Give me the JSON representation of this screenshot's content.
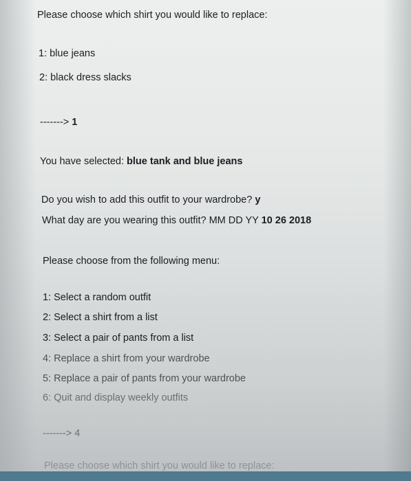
{
  "console": {
    "header_prompt": "Please choose which shirt you would like to replace:",
    "pants_options": [
      "1: blue jeans",
      "2: black dress slacks"
    ],
    "first_input": {
      "prompt": "-------> ",
      "value": "1"
    },
    "selection": {
      "label": "You have selected: ",
      "value": "blue tank and blue jeans"
    },
    "wardrobe_question": {
      "label": "Do you wish to add this outfit to your wardrobe? ",
      "value": "y"
    },
    "day_question": {
      "label": "What day are you wearing this outfit? MM DD YY  ",
      "value": "10 26 2018"
    },
    "menu_title": "Please choose from the following menu:",
    "menu_items": [
      "1: Select a random outfit",
      "2: Select a shirt from a list",
      "3: Select a pair of pants from a list",
      "4: Replace a shirt from your wardrobe",
      "5: Replace a pair of pants from your wardrobe",
      "6: Quit and display weekly outfits"
    ],
    "second_input": {
      "prompt": "-------> ",
      "value": "4"
    },
    "footer_prompt": "Please choose which shirt you would like to replace:"
  },
  "colors": {
    "text": "#1b1e22",
    "taskbar": "#4f7a8f"
  }
}
